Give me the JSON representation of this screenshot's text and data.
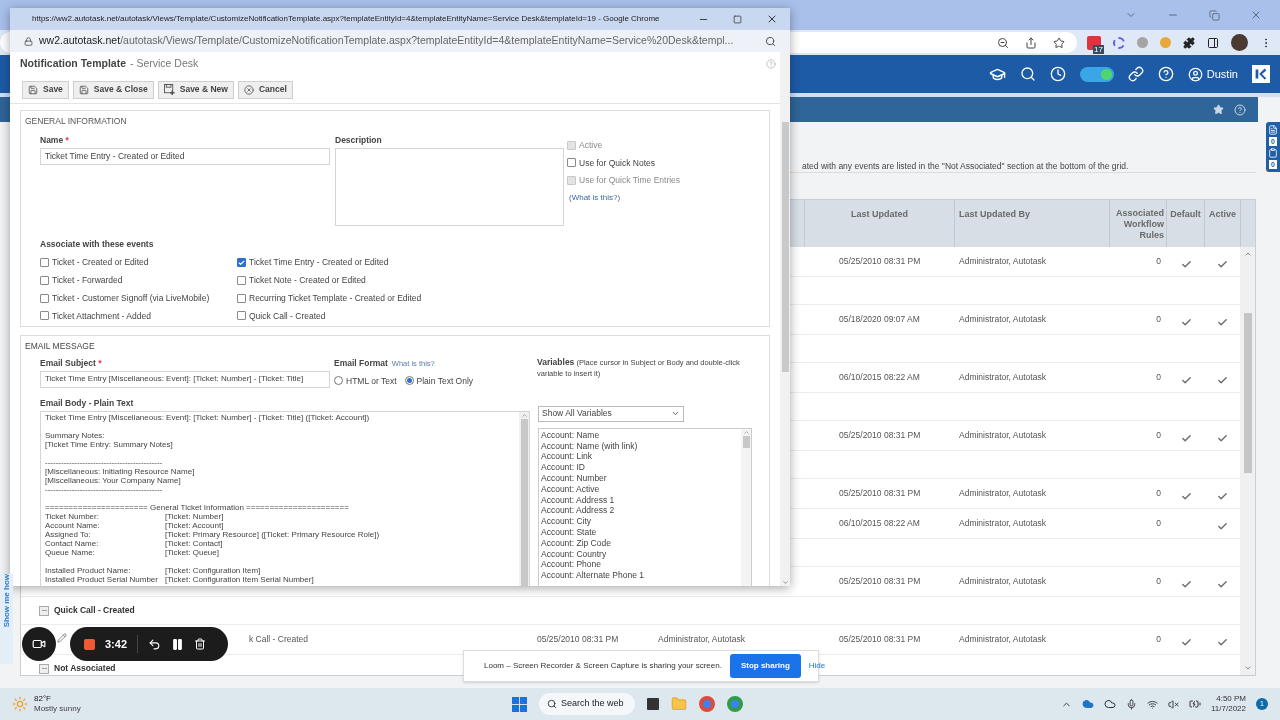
{
  "browser": {
    "extension_badge": "17",
    "header": {
      "toggle_on": true,
      "user": "Dustin"
    },
    "info_text": "ated with any events are listed in the \"Not Associated\" section at the bottom of the grid.",
    "side_counters": [
      "0",
      "0"
    ],
    "help_tab": "Show me how",
    "table": {
      "columns": [
        "Last Updated",
        "Last Updated By",
        "Associated Workflow Rules",
        "Default",
        "Active"
      ],
      "rows": [
        {
          "kind": "event",
          "last_updated": "05/25/2010 08:31 PM",
          "updated_by": "Administrator, Autotask",
          "rules": "0",
          "default": true,
          "active": true
        },
        {
          "kind": "group"
        },
        {
          "kind": "event",
          "last_updated": "05/18/2020 09:07 AM",
          "updated_by": "Administrator, Autotask",
          "rules": "0",
          "default": true,
          "active": true
        },
        {
          "kind": "group"
        },
        {
          "kind": "event",
          "last_updated": "06/10/2015 08:22 AM",
          "updated_by": "Administrator, Autotask",
          "rules": "0",
          "default": true,
          "active": true
        },
        {
          "kind": "group"
        },
        {
          "kind": "event",
          "last_updated": "05/25/2010 08:31 PM",
          "updated_by": "Administrator, Autotask",
          "rules": "0",
          "default": true,
          "active": true
        },
        {
          "kind": "group"
        },
        {
          "kind": "event",
          "last_updated": "05/25/2010 08:31 PM",
          "updated_by": "Administrator, Autotask",
          "rules": "0",
          "default": true,
          "active": true
        },
        {
          "kind": "event",
          "last_updated": "06/10/2015 08:22 AM",
          "updated_by": "Administrator, Autotask",
          "rules": "0",
          "default": false,
          "active": true
        },
        {
          "kind": "group"
        },
        {
          "kind": "event",
          "last_updated": "05/25/2010 08:31 PM",
          "updated_by": "Administrator, Autotask",
          "rules": "0",
          "default": true,
          "active": true
        },
        {
          "kind": "group",
          "label": "Quick Call - Created",
          "expanded": true
        },
        {
          "kind": "event",
          "name": "k Call - Created",
          "ghost_cells": [
            "05/25/2010 08:31 PM",
            "Administrator, Autotask"
          ],
          "last_updated": "05/25/2010 08:31 PM",
          "updated_by": "Administrator, Autotask",
          "rules": "0",
          "default": true,
          "active": true
        },
        {
          "kind": "group",
          "label": "Not Associated",
          "expanded": true
        }
      ]
    }
  },
  "popup": {
    "title": "https://ww2.autotask.net/autotask/Views/Template/CustomizeNotificationTemplate.aspx?templateEntityId=4&templateEntityName=Service Desk&templateId=19 - Google Chrome",
    "url_host": "ww2.autotask.net",
    "url_path": "/autotask/Views/Template/CustomizeNotificationTemplate.aspx?templateEntityId=4&templateEntityName=Service%20Desk&templ...",
    "page_title": "Notification Template",
    "page_subtitle": "- Service Desk",
    "toolbar": [
      {
        "label": "Save",
        "kind": "save"
      },
      {
        "label": "Save & Close",
        "kind": "save"
      },
      {
        "label": "Save & New",
        "kind": "new"
      },
      {
        "label": "Cancel",
        "kind": "cancel"
      }
    ],
    "general": {
      "heading": "GENERAL INFORMATION",
      "name_label": "Name",
      "name_required_mark": "*",
      "name_value": "Ticket Time Entry - Created or Edited",
      "description_label": "Description",
      "options": [
        {
          "label": "Active",
          "checked": false,
          "disabled": true
        },
        {
          "label": "Use for Quick Notes",
          "checked": false,
          "disabled": false
        },
        {
          "label": "Use for Quick Time Entries",
          "checked": false,
          "disabled": true
        }
      ],
      "help_link": "(What is this?)",
      "events_label": "Associate with these events",
      "events": [
        {
          "label": "Ticket - Created or Edited",
          "checked": false
        },
        {
          "label": "Ticket Time Entry - Created or Edited",
          "checked": true
        },
        {
          "label": "Ticket - Forwarded",
          "checked": false
        },
        {
          "label": "Ticket Note - Created or Edited",
          "checked": false
        },
        {
          "label": "Ticket - Customer Signoff (via LiveMobile)",
          "checked": false
        },
        {
          "label": "Recurring Ticket Template - Created or Edited",
          "checked": false
        },
        {
          "label": "Ticket Attachment - Added",
          "checked": false
        },
        {
          "label": "Quick Call - Created",
          "checked": false
        }
      ]
    },
    "email": {
      "heading": "EMAIL MESSAGE",
      "subject_label": "Email Subject",
      "subject_required_mark": "*",
      "subject_value": "Ticket Time Entry [Miscellaneous: Event]: [Ticket: Number] - [Ticket: Title]",
      "format_label": "Email Format",
      "format_help": "What is this?",
      "formats": [
        {
          "label": "HTML or Text",
          "selected": false
        },
        {
          "label": "Plain Text Only",
          "selected": true
        }
      ],
      "variables_label": "Variables",
      "variables_hint": "(Place cursor in Subject or Body and double-click variable to insert it)",
      "body_label": "Email Body - Plain Text",
      "body_lines": [
        {
          "kind": "text",
          "text": "Ticket Time Entry [Miscellaneous: Event]: [Ticket: Number] - [Ticket: Title] ([Ticket: Account])"
        },
        {
          "kind": "blank"
        },
        {
          "kind": "text",
          "text": "Summary Notes:"
        },
        {
          "kind": "text",
          "text": "[Ticket Time Entry: Summary Notes]"
        },
        {
          "kind": "blank"
        },
        {
          "kind": "text",
          "text": "--------------------------------------------"
        },
        {
          "kind": "text",
          "text": "[Miscellaneous: Initiating Resource Name]"
        },
        {
          "kind": "text",
          "text": "[Miscellaneous: Your Company Name]"
        },
        {
          "kind": "text",
          "text": "--------------------------------------------"
        },
        {
          "kind": "blank"
        },
        {
          "kind": "text",
          "text": "====================== General Ticket Information ======================"
        },
        {
          "kind": "pair",
          "label": "Ticket Number:",
          "value": "[Ticket: Number]"
        },
        {
          "kind": "pair",
          "label": "Account Name:",
          "value": "[Ticket: Account]"
        },
        {
          "kind": "pair",
          "label": "Assigned To:",
          "value": "[Ticket: Primary Resource] ([Ticket: Primary Resource Role])"
        },
        {
          "kind": "pair",
          "label": "Contact Name:",
          "value": "[Ticket: Contact]"
        },
        {
          "kind": "pair",
          "label": "Queue Name:",
          "value": "[Ticket: Queue]"
        },
        {
          "kind": "blank"
        },
        {
          "kind": "pair",
          "label": "Installed Product Name:",
          "value": "[Ticket: Configuration Item]"
        },
        {
          "kind": "pair",
          "label": "Installed Product Serial Number",
          "value": "[Ticket: Configuration Item Serial Number]"
        }
      ],
      "variable_filter": "Show All Variables",
      "variables": [
        "Account: Name",
        "Account: Name (with link)",
        "Account: Link",
        "Account: ID",
        "Account: Number",
        "Account: Active",
        "Account: Address 1",
        "Account: Address 2",
        "Account: City",
        "Account: State",
        "Account: Zip Code",
        "Account: Country",
        "Account: Phone",
        "Account: Alternate Phone 1"
      ]
    }
  },
  "loom": {
    "timer": "3:42",
    "message": "Loom – Screen Recorder & Screen Capture is sharing your screen.",
    "stop_button": "Stop sharing",
    "hide_link": "Hide"
  },
  "taskbar": {
    "temperature": "82°F",
    "weather": "Mostly sunny",
    "search": "Search the web",
    "time": "4:50 PM",
    "date": "11/7/2022",
    "notification_count": "1"
  }
}
